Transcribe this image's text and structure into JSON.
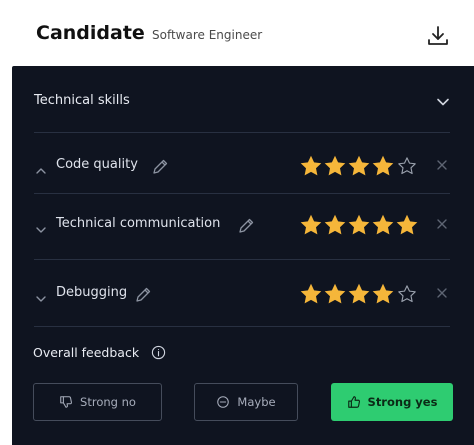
{
  "header": {
    "title": "Candidate",
    "role": "Software Engineer"
  },
  "section": {
    "title": "Technical skills",
    "skills": [
      {
        "label": "Code quality",
        "rating": 4,
        "max": 5
      },
      {
        "label": "Technical communication",
        "rating": 5,
        "max": 5
      },
      {
        "label": "Debugging",
        "rating": 4,
        "max": 5
      }
    ]
  },
  "feedback": {
    "label": "Overall feedback",
    "options": {
      "strong_no": "Strong no",
      "maybe": "Maybe",
      "strong_yes": "Strong yes"
    }
  },
  "colors": {
    "panel": "#0f1420",
    "star_filled": "#f5b63a",
    "star_empty": "#9aa1ad",
    "accent_green": "#2ecc71"
  },
  "icons": {
    "download": "download-icon",
    "chevron": "chevron-icon",
    "edit": "pencil-icon",
    "remove": "close-icon",
    "info": "info-icon",
    "thumbs_down": "thumbs-down-icon",
    "neutral": "minus-circle-icon",
    "thumbs_up": "thumbs-up-icon"
  }
}
